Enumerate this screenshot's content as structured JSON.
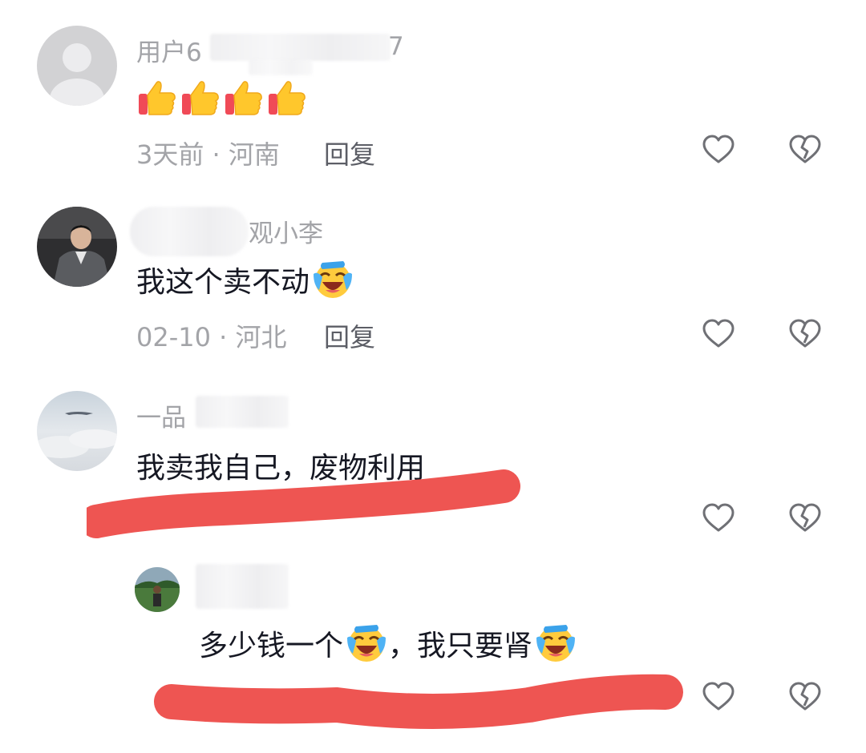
{
  "comments": [
    {
      "username": "用户6",
      "username_tail": "7",
      "content": "",
      "emoji": [
        "thumbs-up",
        "thumbs-up",
        "thumbs-up",
        "thumbs-up"
      ],
      "meta": "3天前 · 河南",
      "reply": "回复"
    },
    {
      "username": "观小李",
      "content": "我这个卖不动",
      "meta": "02-10 · 河北",
      "reply": "回复"
    },
    {
      "username": "一品",
      "content": "我卖我自己，废物利用"
    },
    {
      "content_a": "多少钱一个",
      "content_b": "，我只要肾"
    }
  ],
  "icons": {
    "like": "heart-outline-icon",
    "dislike": "broken-heart-icon"
  },
  "colors": {
    "scribble": "#ee5552",
    "meta": "#a3a4a8",
    "reply": "#5c5e66"
  }
}
